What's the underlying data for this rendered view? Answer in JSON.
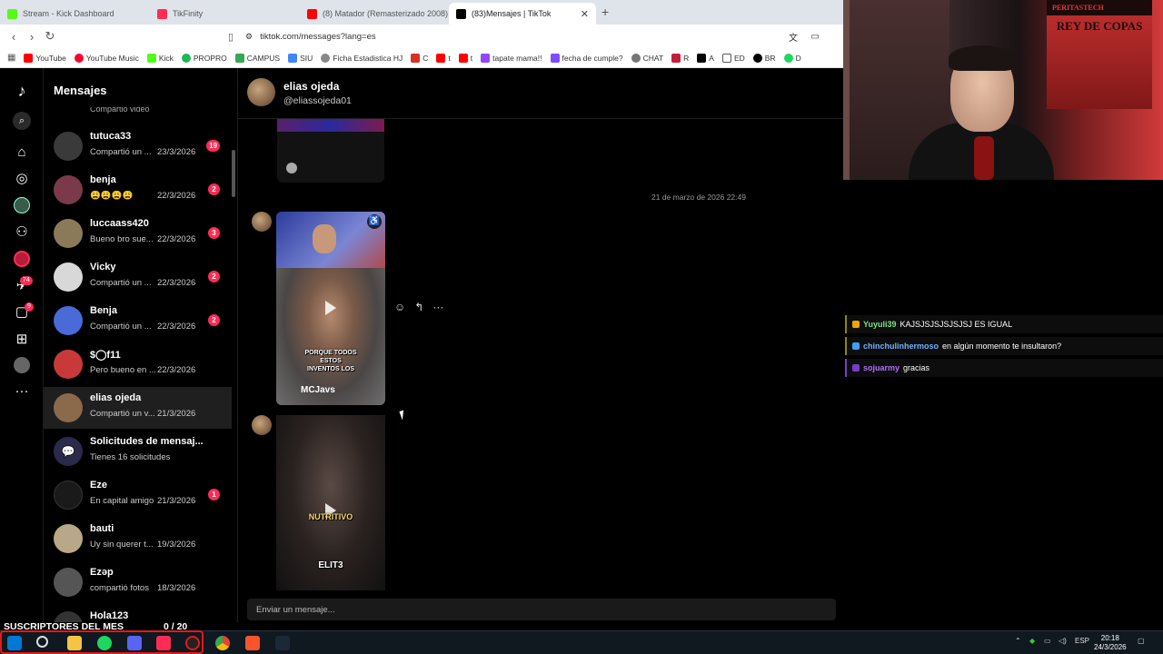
{
  "browser": {
    "tabs": [
      {
        "title": "Stream - Kick Dashboard",
        "color": "#53fc18"
      },
      {
        "title": "TikFinity",
        "color": "#fe2c55"
      },
      {
        "title": "(8) Matador (Remasterizado 2008) - ",
        "color": "#ff0000"
      },
      {
        "title": "(83)Mensajes | TikTok",
        "color": "#000000"
      }
    ],
    "url": "tiktok.com/messages?lang=es",
    "bookmarks": [
      {
        "label": "YouTube",
        "color": "#ff0000"
      },
      {
        "label": "YouTube Music",
        "color": "#ff0033"
      },
      {
        "label": "Kick",
        "color": "#53fc18"
      },
      {
        "label": "PROPRO",
        "color": "#1db954"
      },
      {
        "label": "CAMPUS",
        "color": "#34a853"
      },
      {
        "label": "SIU",
        "color": "#4285f4"
      },
      {
        "label": "Ficha Estadistica HJ",
        "color": "#888888"
      },
      {
        "label": "C",
        "color": "#d93025"
      },
      {
        "label": "t",
        "color": "#ff0000"
      },
      {
        "label": "t",
        "color": "#ff0000"
      },
      {
        "label": "tapate mama!!",
        "color": "#9146ff"
      },
      {
        "label": "fecha de cumple?",
        "color": "#7c4dff"
      },
      {
        "label": "CHAT",
        "color": "#777777"
      },
      {
        "label": "R",
        "color": "#c41e3a"
      },
      {
        "label": "A",
        "color": "#000000"
      },
      {
        "label": "ED",
        "color": "#555555"
      },
      {
        "label": "BR",
        "color": "#000000"
      },
      {
        "label": "D",
        "color": "#1ed760"
      }
    ]
  },
  "sidebar": {
    "title": "Mensajes",
    "rail_badges": {
      "inbox": "74",
      "activity": "9"
    },
    "top_partial": "Compartió video",
    "conversations": [
      {
        "name": "tutuca33",
        "preview": "Compartió un ...",
        "date": "23/3/2026",
        "badge": "19",
        "avatar": "#3a3a3a"
      },
      {
        "name": "benja",
        "preview": "😩😩😩😩",
        "date": "22/3/2026",
        "badge": "2",
        "avatar": "#7a3a4a"
      },
      {
        "name": "luccaass420",
        "preview": "Bueno bro sue...",
        "date": "22/3/2026",
        "badge": "3",
        "avatar": "#8a7a5a"
      },
      {
        "name": "Vicky",
        "preview": "Compartió un ...",
        "date": "22/3/2026",
        "badge": "2",
        "avatar": "#e8e8e8"
      },
      {
        "name": "Benja",
        "preview": "Compartió un ...",
        "date": "22/3/2026",
        "badge": "2",
        "avatar": "#4a6ad8"
      },
      {
        "name": "$◯f11",
        "preview": "Pero bueno en ...",
        "date": "22/3/2026",
        "badge": "",
        "avatar": "#c83a3a"
      },
      {
        "name": "elias ojeda",
        "preview": "Compartió un v...",
        "date": "21/3/2026",
        "badge": "",
        "avatar": "#8a6a4a"
      },
      {
        "name": "Solicitudes de mensaj...",
        "preview": "Tienes 16 solicitudes",
        "date": "",
        "badge": "",
        "avatar": "#2a2a4a"
      },
      {
        "name": "Eze",
        "preview": "En capital amigo",
        "date": "21/3/2026",
        "badge": "1",
        "avatar": "#1a1a1a"
      },
      {
        "name": "bauti",
        "preview": "Uy sin querer t...",
        "date": "19/3/2026",
        "badge": "",
        "avatar": "#b8a888"
      },
      {
        "name": "Ezəp",
        "preview": "compartió fotos",
        "date": "18/3/2026",
        "badge": "",
        "avatar": "#555555"
      },
      {
        "name": "Hola123",
        "preview": "",
        "date": "",
        "badge": "",
        "avatar": "#333333"
      }
    ]
  },
  "chat": {
    "name": "elias ojeda",
    "username": "@eliassojeda01",
    "timestamp": "21 de marzo de 2026 22:49",
    "video1": {
      "caption_lines": [
        "PORQUE TODOS",
        "ESTOS",
        "INVENTOS LOS"
      ],
      "author": "MCJavs"
    },
    "video2": {
      "overlay": "NUTRITIVO",
      "logo": "ELIT3"
    },
    "input_placeholder": "Enviar un mensaje..."
  },
  "stream_chat": [
    {
      "user": "Yuyuli39",
      "text": "KAJSJSJSJSJSJSJ ES IGUAL",
      "user_color": "#7ee27e"
    },
    {
      "user": "chinchulinhermoso",
      "text": "en algún momento te insultaron?",
      "user_color": "#6fb2ff"
    },
    {
      "user": "sojuarmy",
      "text": "gracias",
      "user_color": "#b070ff"
    }
  ],
  "overlay": {
    "subs_label": "SUSCRIPTORES DEL MES",
    "subs_value": "0 / 20",
    "poster_line1": "REY DE COPAS",
    "poster_line2": "PERITASTECH"
  },
  "taskbar": {
    "lang": "ESP",
    "time": "20:18",
    "date": "24/3/2026"
  }
}
